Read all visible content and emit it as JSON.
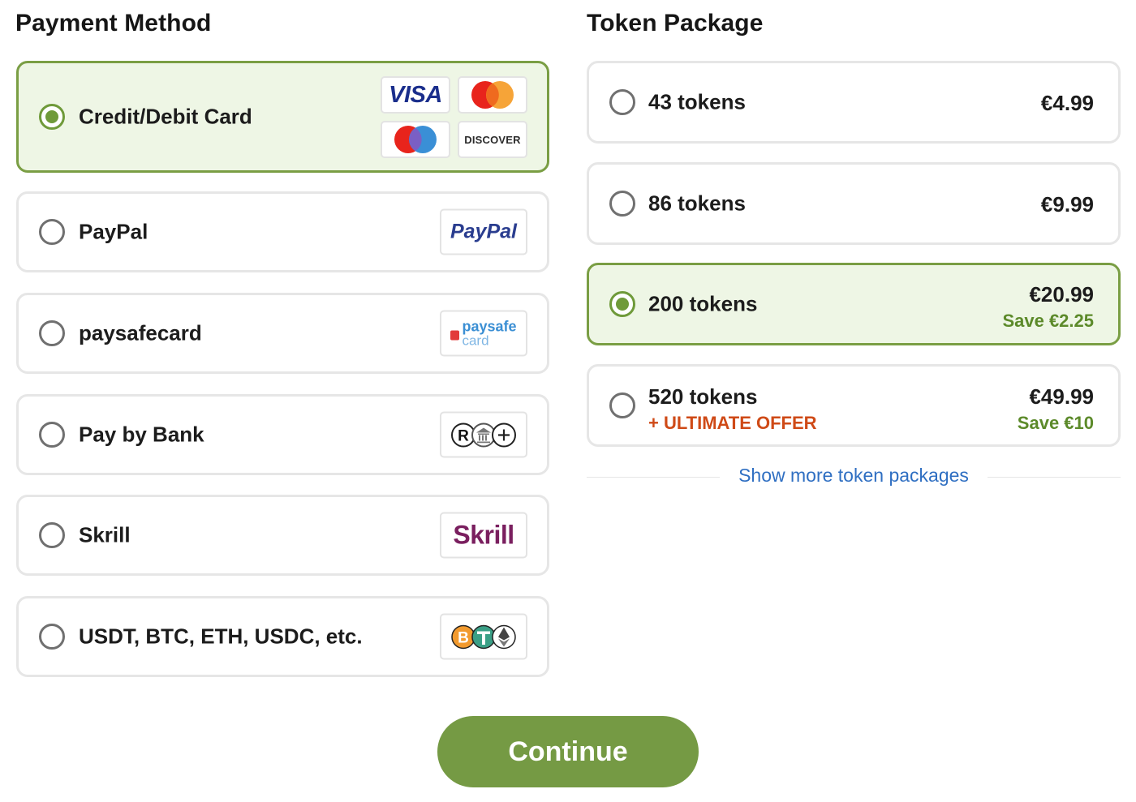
{
  "payment_method": {
    "title": "Payment Method",
    "options": [
      {
        "label": "Credit/Debit Card",
        "selected": true,
        "logos": [
          "VISA",
          "mastercard-icon",
          "maestro-icon",
          "DISCOVER"
        ]
      },
      {
        "label": "PayPal",
        "selected": false,
        "logo_text": "PayPal"
      },
      {
        "label": "paysafecard",
        "selected": false,
        "logo_text_1": "paysafe",
        "logo_text_2": "card"
      },
      {
        "label": "Pay by Bank",
        "selected": false,
        "logo": "bank-transfer-icon"
      },
      {
        "label": "Skrill",
        "selected": false,
        "logo_text": "Skrill"
      },
      {
        "label": "USDT, BTC, ETH, USDC, etc.",
        "selected": false,
        "logo": "crypto-icons"
      }
    ]
  },
  "token_package": {
    "title": "Token Package",
    "options": [
      {
        "name": "43 tokens",
        "price": "€4.99",
        "selected": false
      },
      {
        "name": "86 tokens",
        "price": "€9.99",
        "selected": false
      },
      {
        "name": "200 tokens",
        "price": "€20.99",
        "save": "Save €2.25",
        "selected": true
      },
      {
        "name": "520 tokens",
        "offer": "+ ULTIMATE OFFER",
        "price": "€49.99",
        "save": "Save €10",
        "selected": false
      }
    ],
    "show_more": "Show more token packages"
  },
  "continue_label": "Continue",
  "colors": {
    "accent_green": "#759a44",
    "selected_bg": "#eef6e5",
    "save_green": "#5c8a2a",
    "offer_orange": "#cf4a17",
    "link_blue": "#2f6fc2"
  }
}
